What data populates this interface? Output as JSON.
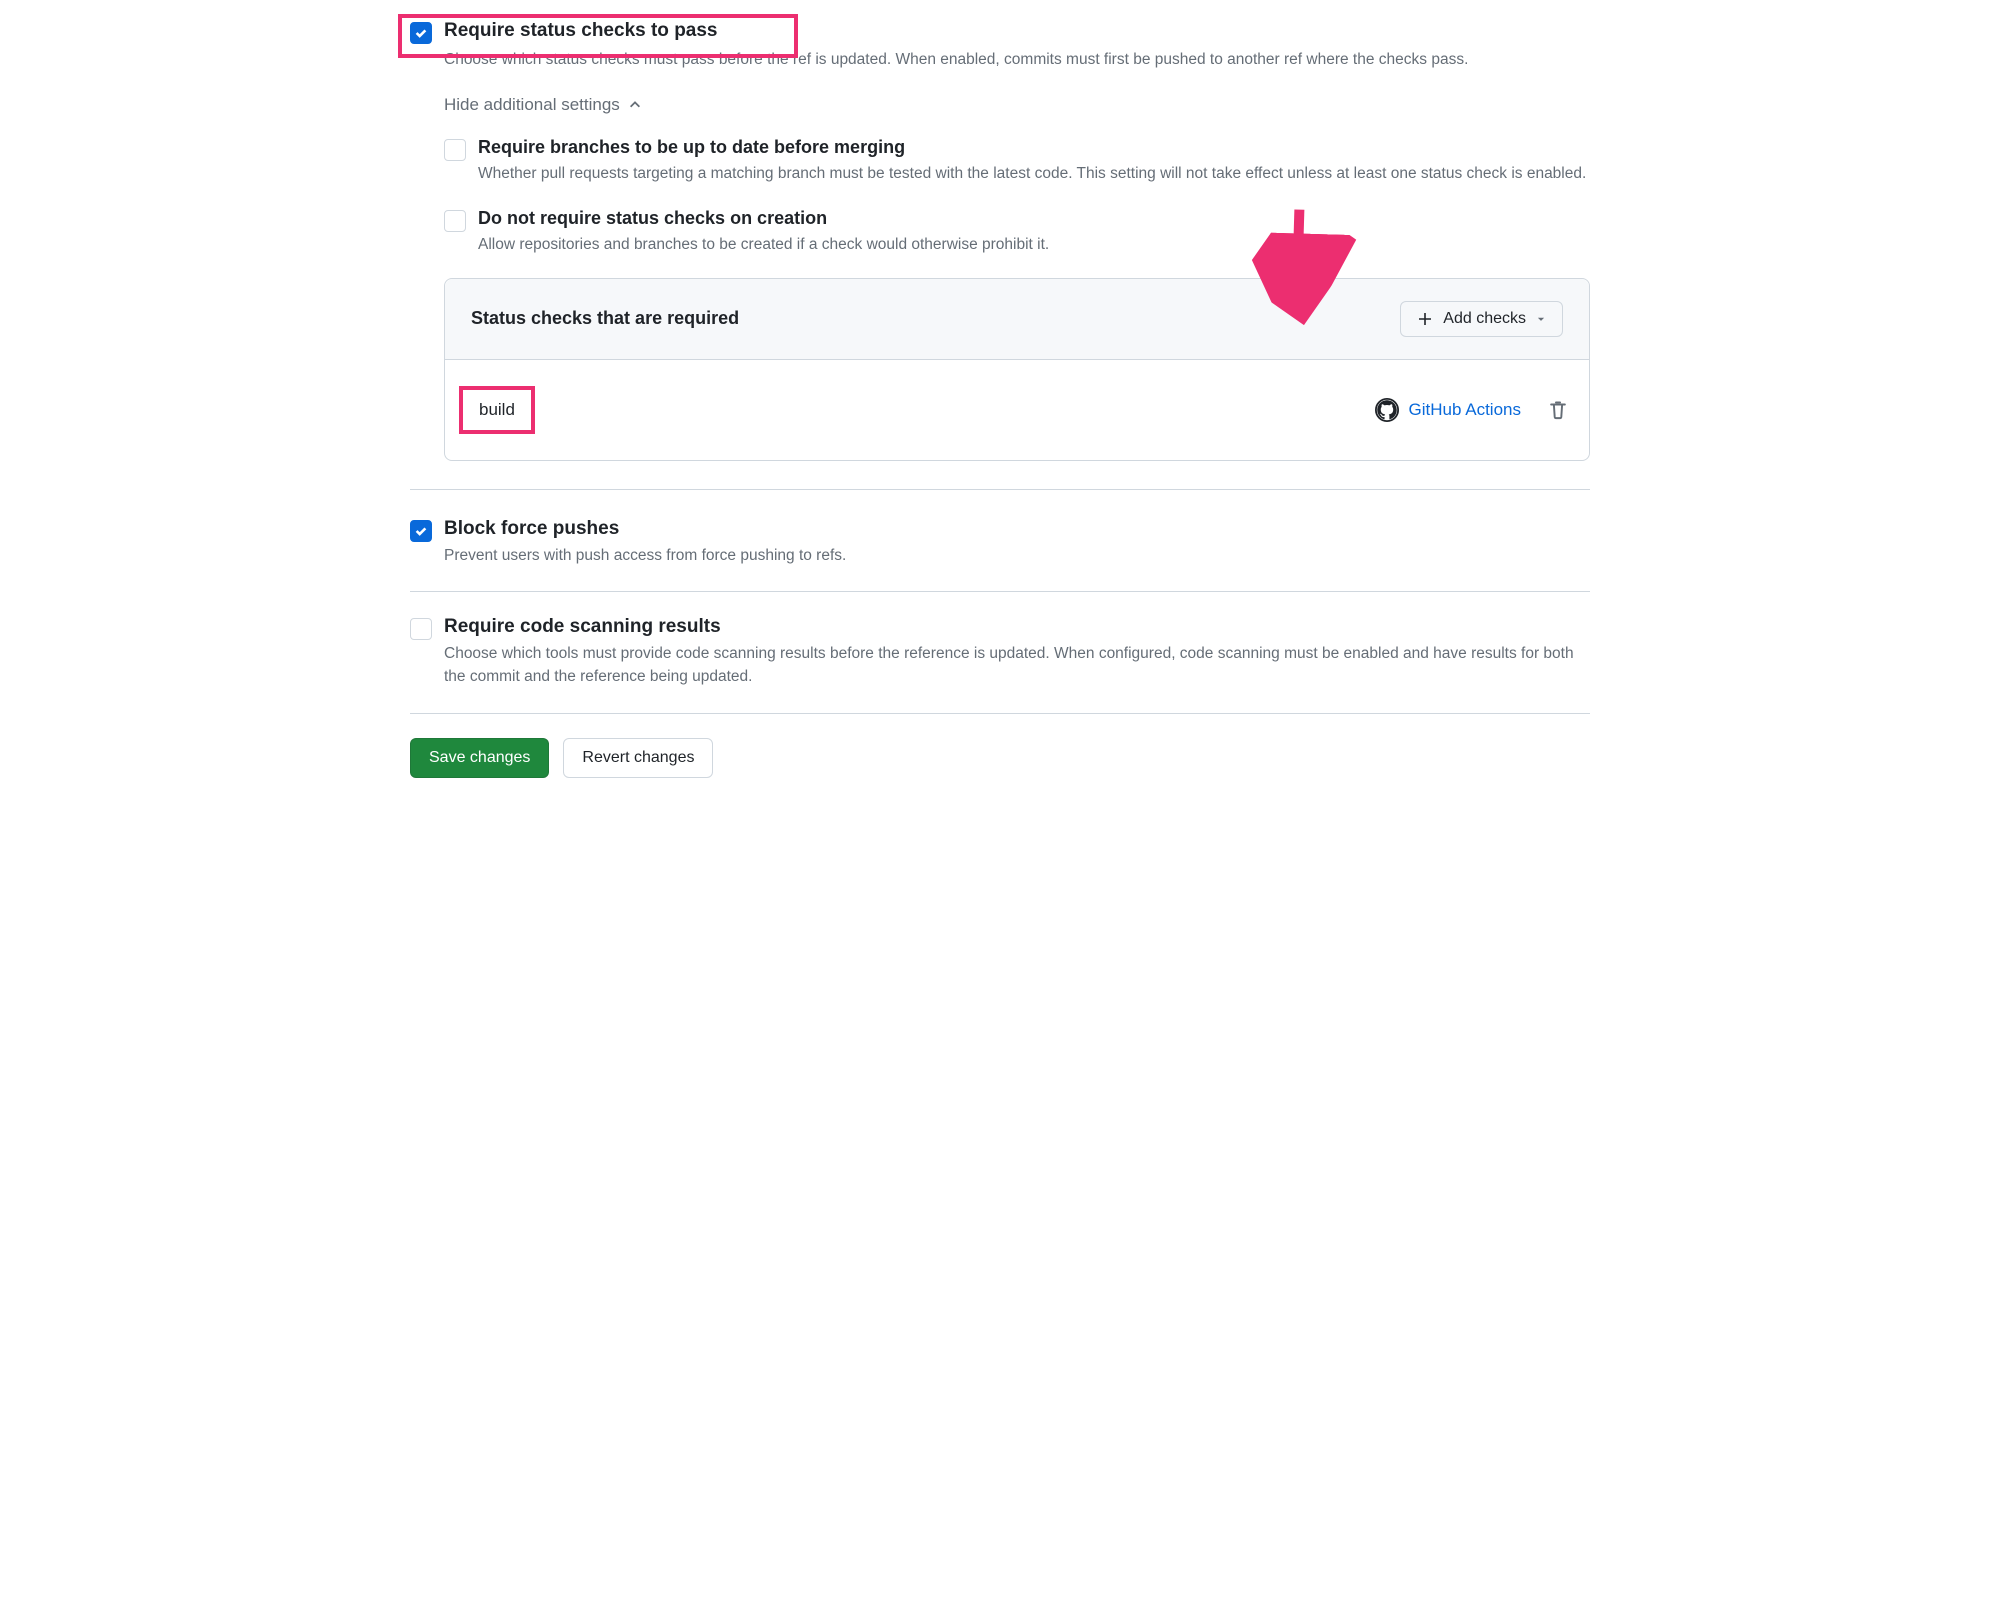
{
  "ruleMain": {
    "title": "Require status checks to pass",
    "desc": "Choose which status checks must pass before the ref is updated. When enabled, commits must first be pushed to another ref where the checks pass.",
    "toggle": "Hide additional settings"
  },
  "subRules": {
    "upToDate": {
      "title": "Require branches to be up to date before merging",
      "desc": "Whether pull requests targeting a matching branch must be tested with the latest code. This setting will not take effect unless at least one status check is enabled."
    },
    "noCheckCreate": {
      "title": "Do not require status checks on creation",
      "desc": "Allow repositories and branches to be created if a check would otherwise prohibit it."
    }
  },
  "statusChecks": {
    "header": "Status checks that are required",
    "addBtn": "Add checks",
    "items": [
      {
        "name": "build",
        "sourceLabel": "GitHub Actions"
      }
    ]
  },
  "blockForce": {
    "title": "Block force pushes",
    "desc": "Prevent users with push access from force pushing to refs."
  },
  "codeScan": {
    "title": "Require code scanning results",
    "desc": "Choose which tools must provide code scanning results before the reference is updated. When configured, code scanning must be enabled and have results for both the commit and the reference being updated."
  },
  "actions": {
    "save": "Save changes",
    "revert": "Revert changes"
  }
}
